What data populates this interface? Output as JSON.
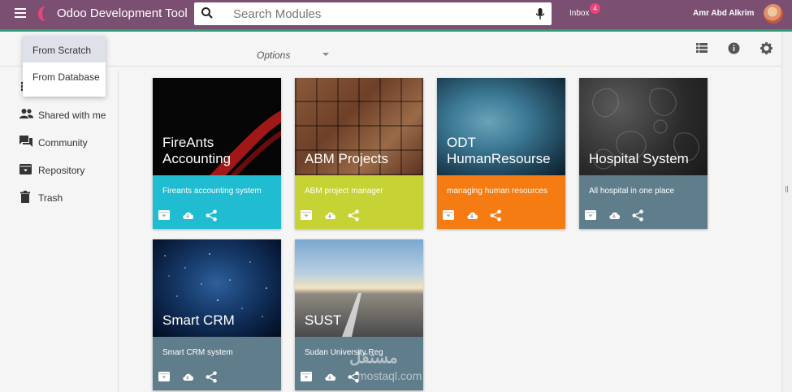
{
  "header": {
    "app_title": "Odoo Development Tool",
    "search_placeholder": "Search Modules",
    "inbox_label": "Inbox",
    "inbox_count": "4",
    "user_name": "Amr Abd Alkrim",
    "bar_color": "#7b4f72",
    "accent_line_color": "#2e9e76"
  },
  "toolbar": {
    "options_label": "Options",
    "icons": [
      "list-view-icon",
      "info-icon",
      "settings-icon"
    ]
  },
  "dropdown": {
    "items": [
      {
        "label": "From Scratch",
        "active": true
      },
      {
        "label": "From Database",
        "active": false
      }
    ]
  },
  "sidebar": {
    "items": [
      {
        "label": "Shared with me",
        "icon": "people-icon"
      },
      {
        "label": "Community",
        "icon": "forum-icon"
      },
      {
        "label": "Repository",
        "icon": "archive-icon"
      },
      {
        "label": "Trash",
        "icon": "trash-icon"
      }
    ]
  },
  "cards": [
    {
      "title": "FireAnts\nAccounting",
      "description": "Fireants accounting system",
      "color": "#1fbcd2"
    },
    {
      "title": "ABM Projects",
      "description": "ABM project manager",
      "color": "#c7d235"
    },
    {
      "title": "ODT\nHumanResourse",
      "description": "managing human resources",
      "color": "#f57c13"
    },
    {
      "title": "Hospital System",
      "description": "All hospital in one place",
      "color": "#607d8b"
    },
    {
      "title": "Smart CRM",
      "description": "Smart CRM system",
      "color": "#607d8b"
    },
    {
      "title": "SUST",
      "description": "Sudan University Reg",
      "color": "#607d8b"
    }
  ],
  "card_action_icons": [
    "archive-icon",
    "cloud-download-icon",
    "share-icon"
  ],
  "watermark": {
    "text": "مستقل",
    "sub": "mostaql.com"
  }
}
